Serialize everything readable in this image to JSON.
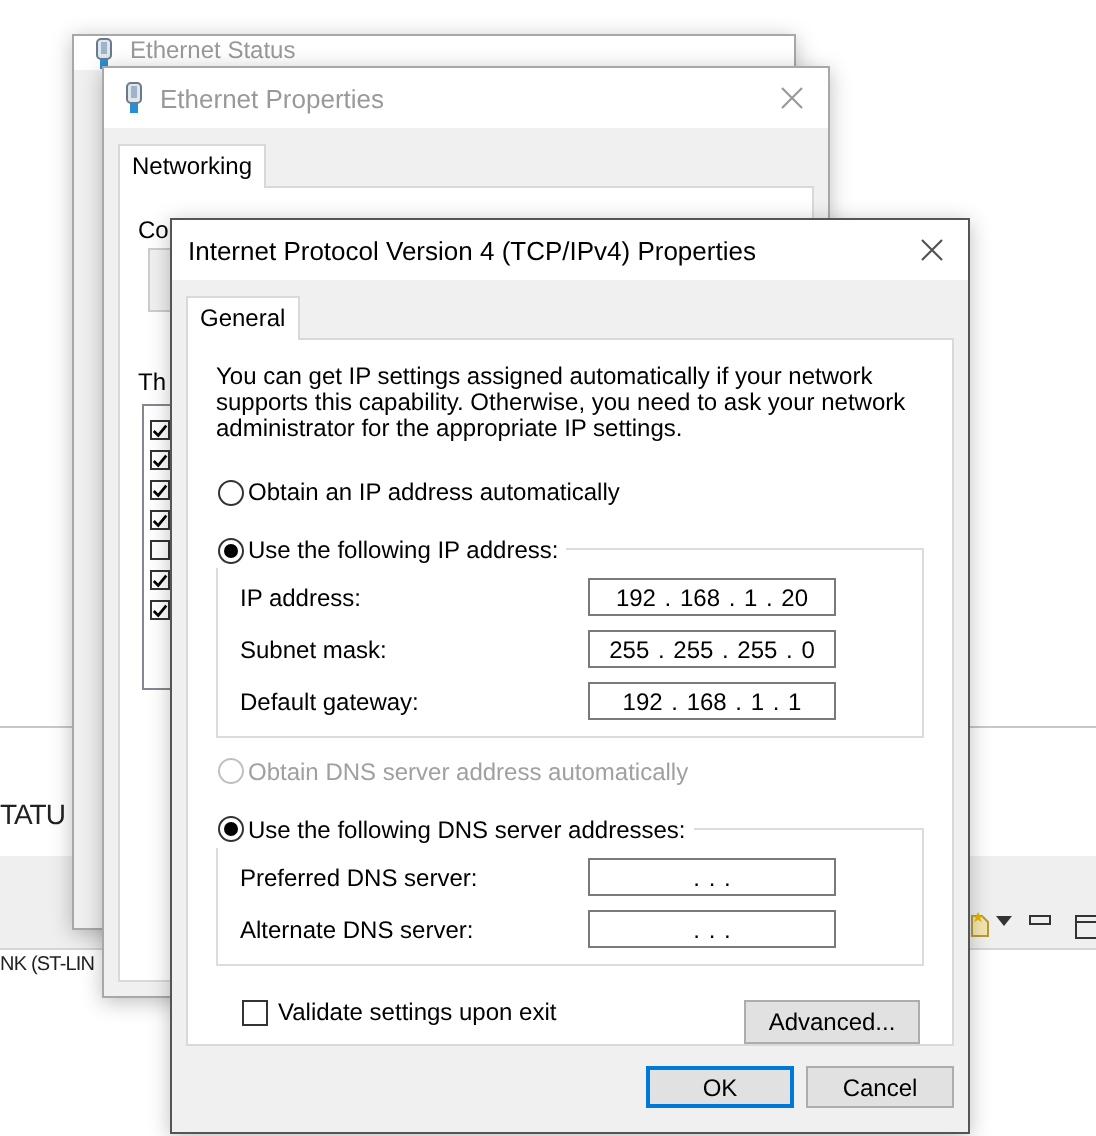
{
  "background_app": {
    "heading": "TATU",
    "device_label": "NK (ST-LIN"
  },
  "ethernet_status": {
    "title": "Ethernet Status"
  },
  "ethernet_properties": {
    "title": "Ethernet Properties",
    "tabs": [
      {
        "label": "Networking",
        "selected": true
      }
    ],
    "connect_label": "Co",
    "components_label": "Th",
    "components": [
      {
        "checked": true
      },
      {
        "checked": true
      },
      {
        "checked": true
      },
      {
        "checked": true
      },
      {
        "checked": false
      },
      {
        "checked": true
      },
      {
        "checked": true
      }
    ]
  },
  "ipv4_dialog": {
    "title": "Internet Protocol Version 4 (TCP/IPv4) Properties",
    "tabs": [
      {
        "label": "General",
        "selected": true
      }
    ],
    "description": "You can get IP settings assigned automatically if your network supports this capability. Otherwise, you need to ask your network administrator for the appropriate IP settings.",
    "ip_options": [
      {
        "label": "Obtain an IP address automatically",
        "selected": false,
        "disabled": false
      },
      {
        "label": "Use the following IP address:",
        "selected": true,
        "disabled": false
      }
    ],
    "ip_fields": [
      {
        "label": "IP address:",
        "value": "192 . 168 . 1 . 20"
      },
      {
        "label": "Subnet mask:",
        "value": "255 . 255 . 255 . 0"
      },
      {
        "label": "Default gateway:",
        "value": "192 . 168 . 1 . 1"
      }
    ],
    "dns_options": [
      {
        "label": "Obtain DNS server address automatically",
        "selected": false,
        "disabled": true
      },
      {
        "label": "Use the following DNS server addresses:",
        "selected": true,
        "disabled": false
      }
    ],
    "dns_fields": [
      {
        "label": "Preferred DNS server:",
        "value": ". . ."
      },
      {
        "label": "Alternate DNS server:",
        "value": ". . ."
      }
    ],
    "validate": {
      "label": "Validate settings upon exit",
      "checked": false
    },
    "advanced_button": "Advanced...",
    "buttons": [
      {
        "label": "OK",
        "default": true
      },
      {
        "label": "Cancel",
        "default": false
      }
    ]
  }
}
